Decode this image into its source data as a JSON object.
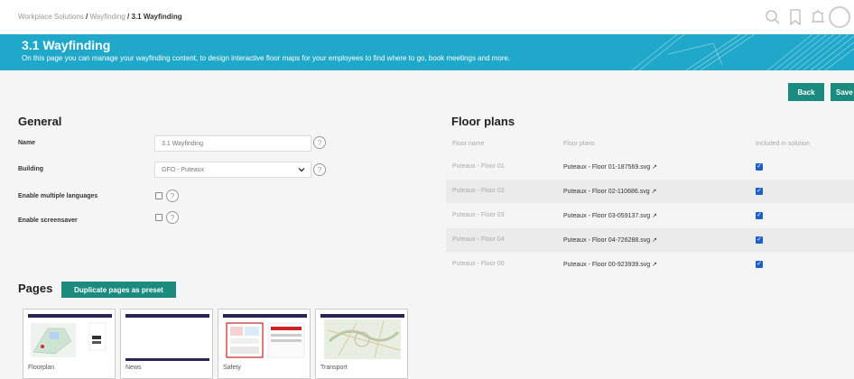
{
  "breadcrumb": {
    "items": [
      "Workplace Solutions",
      "Wayfinding",
      "3.1 Wayfinding"
    ],
    "separator": "/"
  },
  "top_icons": [
    "search-icon",
    "bookmark-icon",
    "bell-icon",
    "avatar"
  ],
  "banner": {
    "title": "3.1 Wayfinding",
    "description": "On this page you can manage your wayfinding content, to design interactive floor maps for your employees to find where to go, book meetings and more."
  },
  "actions": {
    "back_label": "Back",
    "save_label": "Save"
  },
  "general": {
    "heading": "General",
    "name_label": "Name",
    "name_value": "3.1 Wayfinding",
    "building_label": "Building",
    "building_value": "GFO - Puteaux",
    "multilang_label": "Enable multiple languages",
    "screensaver_label": "Enable screensaver",
    "help_glyph": "?"
  },
  "floor_plans": {
    "heading": "Floor plans",
    "columns": [
      "Floor name",
      "Floor plans",
      "Included in solution"
    ],
    "rows": [
      {
        "name": "Puteaux - Floor 01",
        "file": "Puteaux - Floor 01-187569.svg",
        "included": true
      },
      {
        "name": "Puteaux - Floor 02",
        "file": "Puteaux - Floor 02-110686.svg",
        "included": true
      },
      {
        "name": "Puteaux - Floor 03",
        "file": "Puteaux - Floor 03-059137.svg",
        "included": true
      },
      {
        "name": "Puteaux - Floor 04",
        "file": "Puteaux - Floor 04-726288.svg",
        "included": true
      },
      {
        "name": "Puteaux - Floor 00",
        "file": "Puteaux - Floor 00-923939.svg",
        "included": true
      }
    ]
  },
  "pages": {
    "heading": "Pages",
    "duplicate_label": "Duplicate pages as preset",
    "tiles": [
      "Floorplan",
      "News",
      "Safety",
      "Transport"
    ]
  },
  "colors": {
    "banner": "#1fa8c9",
    "button": "#1b8a7f",
    "checkbox": "#1f5fcc"
  }
}
